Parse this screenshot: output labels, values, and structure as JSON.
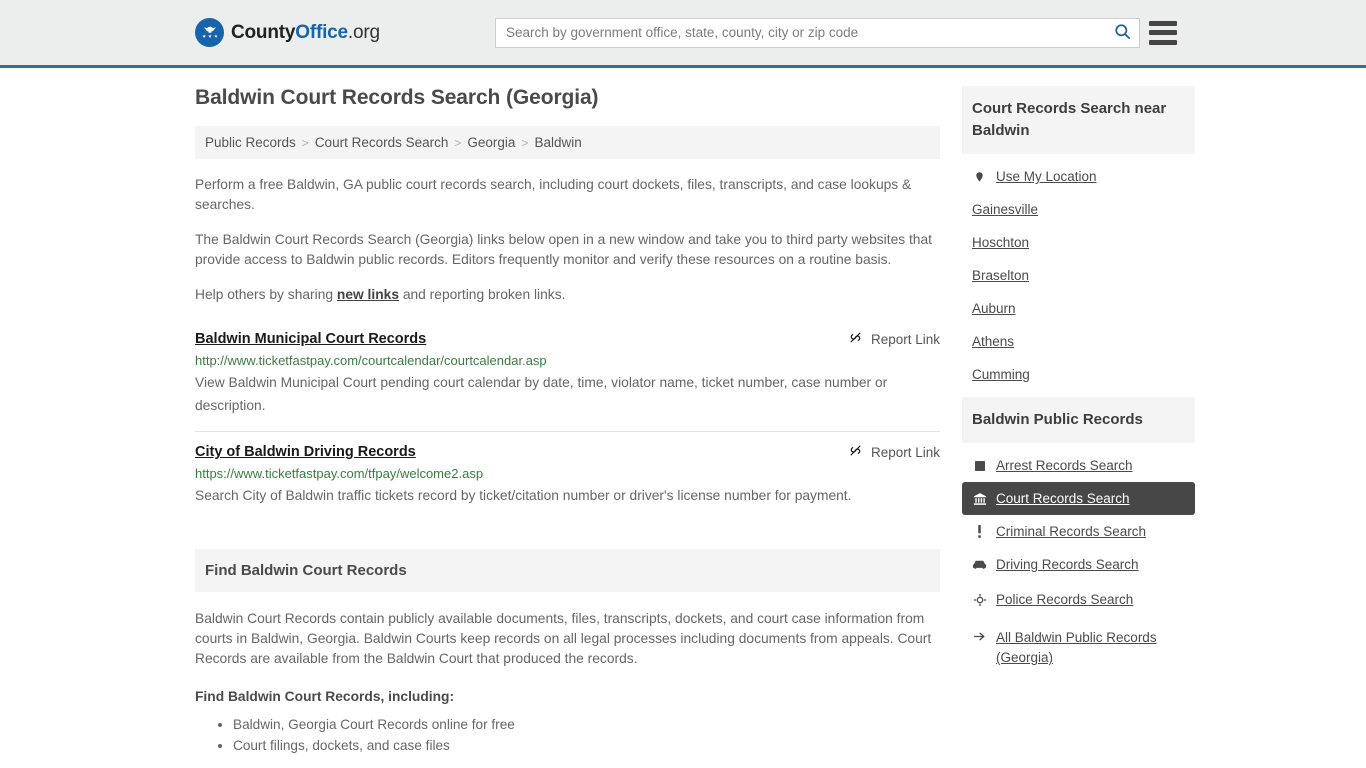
{
  "header": {
    "logo": {
      "part1": "County",
      "part2": "Office",
      "tld": ".org",
      "icon": "eagle-seal-icon"
    },
    "search": {
      "placeholder": "Search by government office, state, county, city or zip code",
      "value": "",
      "button_icon": "search-icon"
    },
    "menu_icon": "hamburger-menu-icon",
    "accent_color": "#31709b"
  },
  "page_title": "Baldwin Court Records Search (Georgia)",
  "breadcrumb": {
    "items": [
      "Public Records",
      "Court Records Search",
      "Georgia",
      "Baldwin"
    ],
    "separator": ">"
  },
  "intro": {
    "p1": "Perform a free Baldwin, GA public court records search, including court dockets, files, transcripts, and case lookups & searches.",
    "p2": "The Baldwin Court Records Search (Georgia) links below open in a new window and take you to third party websites that provide access to Baldwin public records. Editors frequently monitor and verify these resources on a routine basis.",
    "p3_before": "Help others by sharing ",
    "p3_link": "new links",
    "p3_after": " and reporting broken links."
  },
  "results": {
    "report_label": "Report Link",
    "report_icon": "broken-link-icon",
    "items": [
      {
        "title": "Baldwin Municipal Court Records",
        "url": "http://www.ticketfastpay.com/courtcalendar/courtcalendar.asp",
        "description": "View Baldwin Municipal Court pending court calendar by date, time, violator name, ticket number, case number or description."
      },
      {
        "title": "City of Baldwin Driving Records",
        "url": "https://www.ticketfastpay.com/tfpay/welcome2.asp",
        "description": "Search City of Baldwin traffic tickets record by ticket/citation number or driver's license number for payment."
      }
    ]
  },
  "find_section": {
    "heading": "Find Baldwin Court Records",
    "paragraph": "Baldwin Court Records contain publicly available documents, files, transcripts, dockets, and court case information from courts in Baldwin, Georgia. Baldwin Courts keep records on all legal processes including documents from appeals. Court Records are available from the Baldwin Court that produced the records.",
    "list_lead": "Find Baldwin Court Records, including:",
    "list_items": [
      "Baldwin, Georgia Court Records online for free",
      "Court filings, dockets, and case files"
    ]
  },
  "sidebar": {
    "nearby": {
      "heading": "Court Records Search near Baldwin",
      "items": [
        {
          "label": "Use My Location",
          "icon": "map-pin-icon"
        },
        {
          "label": "Gainesville",
          "icon": ""
        },
        {
          "label": "Hoschton",
          "icon": ""
        },
        {
          "label": "Braselton",
          "icon": ""
        },
        {
          "label": "Auburn",
          "icon": ""
        },
        {
          "label": "Athens",
          "icon": ""
        },
        {
          "label": "Cumming",
          "icon": ""
        }
      ]
    },
    "public_records": {
      "heading": "Baldwin Public Records",
      "active_index": 1,
      "items": [
        {
          "label": "Arrest Records Search",
          "icon": "building-square-icon"
        },
        {
          "label": "Court Records Search",
          "icon": "courthouse-icon"
        },
        {
          "label": "Criminal Records Search",
          "icon": "exclamation-icon"
        },
        {
          "label": "Driving Records Search",
          "icon": "car-icon"
        },
        {
          "label": "Police Records Search",
          "icon": "police-badge-icon"
        },
        {
          "label": "All Baldwin Public Records (Georgia)",
          "icon": "arrow-right-icon"
        }
      ]
    },
    "active_bg_color": "#474747"
  }
}
